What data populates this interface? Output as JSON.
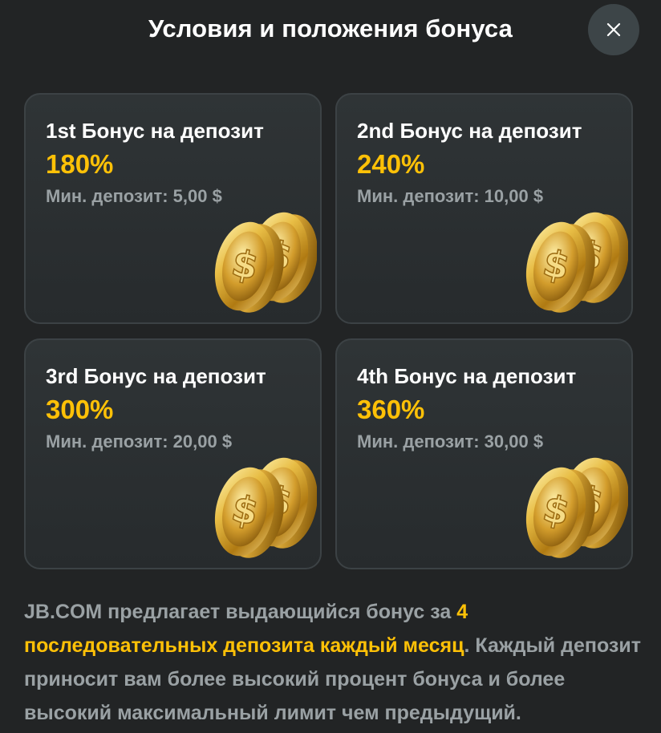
{
  "header": {
    "title": "Условия и положения бонуса",
    "close_icon": "close-icon"
  },
  "cards": [
    {
      "title": "1st Бонус на депозит",
      "percent": "180%",
      "min_deposit": "Мин. депозит: 5,00 $",
      "icon": "gold-coins-icon"
    },
    {
      "title": "2nd Бонус на депозит",
      "percent": "240%",
      "min_deposit": "Мин. депозит: 10,00 $",
      "icon": "gold-coins-icon"
    },
    {
      "title": "3rd Бонус на депозит",
      "percent": "300%",
      "min_deposit": "Мин. депозит: 20,00 $",
      "icon": "gold-coins-icon"
    },
    {
      "title": "4th Бонус на депозит",
      "percent": "360%",
      "min_deposit": "Мин. депозит: 30,00 $",
      "icon": "gold-coins-icon"
    }
  ],
  "description": {
    "part1": "JB.COM предлагает выдающийся бонус за ",
    "highlight": "4 последовательных депозита каждый месяц",
    "part2": ". Каждый депозит приносит вам более высокий процент бонуса и более высокий максимальный лимит чем предыдущий."
  },
  "colors": {
    "background": "#222425",
    "accent": "#ffc107",
    "muted_text": "#9aa1a4",
    "card_border": "#3c4245",
    "close_button_bg": "#3d4548"
  }
}
